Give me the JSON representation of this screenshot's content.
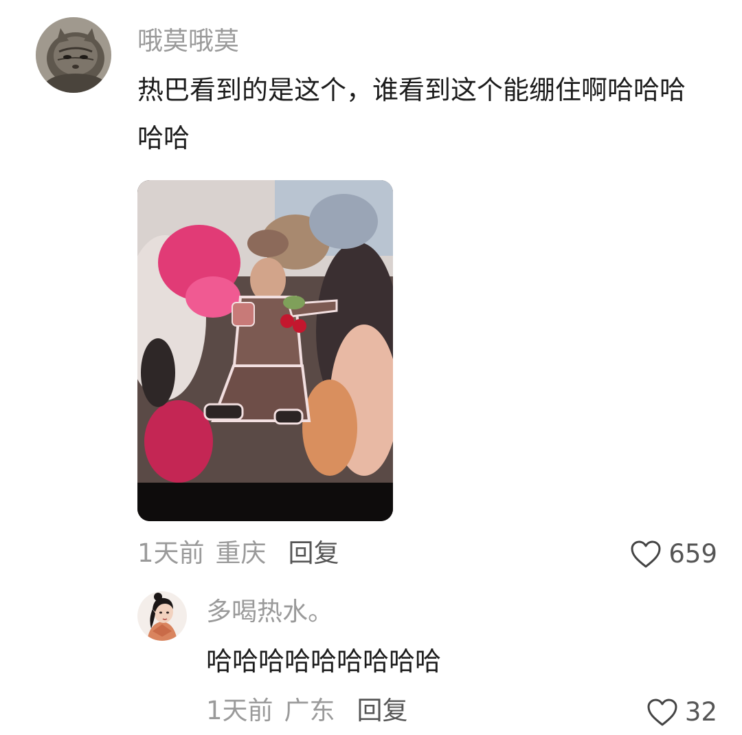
{
  "comment": {
    "avatar_icon": "cat-avatar",
    "username": "哦莫哦莫",
    "text": "热巴看到的是这个，谁看到这个能绷住啊哈哈哈\n哈哈",
    "image_alt": "comment-photo",
    "time": "1天前",
    "location": "重庆",
    "reply_label": "回复",
    "like_icon": "heart-outline-icon",
    "like_count": "659"
  },
  "reply": {
    "avatar_icon": "illustrated-girl-avatar",
    "username": "多喝热水。",
    "text": "哈哈哈哈哈哈哈哈哈",
    "time": "1天前",
    "location": "广东",
    "reply_label": "回复",
    "like_icon": "heart-outline-icon",
    "like_count": "32"
  },
  "colors": {
    "username": "#9a9a9a",
    "text": "#1c1c1c",
    "meta": "#9a9a9a",
    "action": "#555555",
    "background": "#ffffff"
  }
}
